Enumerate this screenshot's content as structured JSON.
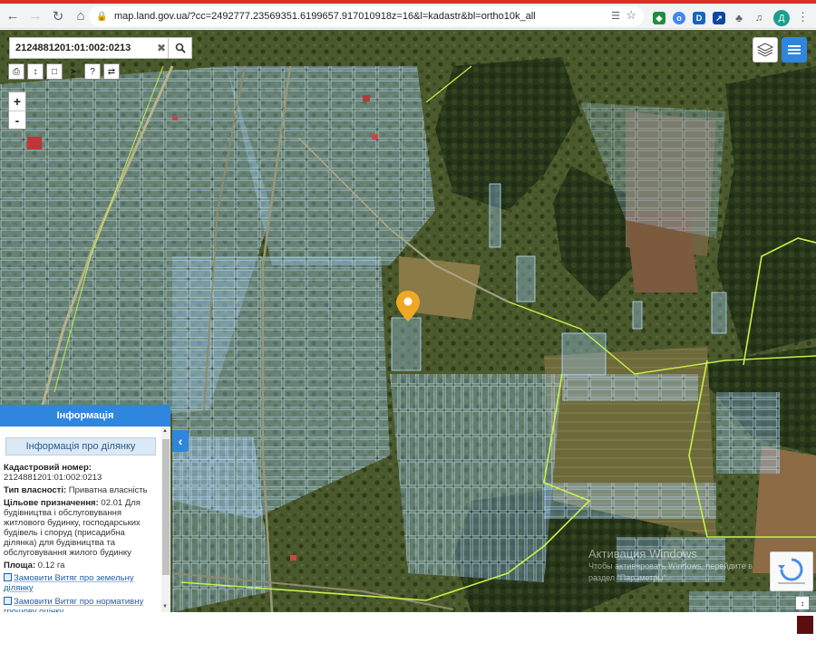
{
  "browser": {
    "url": "map.land.gov.ua/?cc=2492777.23569351.6199657.917010918z=16&l=kadastr&bl=ortho10k_all",
    "avatar_letter": "Д",
    "accent": "#d93025"
  },
  "search": {
    "value": "2124881201:01:002:0213"
  },
  "panel": {
    "header": "Інформація",
    "subheader": "Інформація про ділянку",
    "cadastral_label": "Кадастровий номер:",
    "cadastral_value": "2124881201:01:002:0213",
    "ownership_label": "Тип власності:",
    "ownership_value": "Приватна власність",
    "purpose_label": "Цільове призначення:",
    "purpose_value": "02.01 Для будівництва і обслуговування житлового будинку, господарських будівель і споруд (присадибна ділянка) для будівництва та обслуговування жилого будинку",
    "area_label": "Площа:",
    "area_value": "0.12 га",
    "link1": "Замовити Витяг про земельну ділянку",
    "link2": "Замовити Витяг про нормативну грошову оцінку"
  },
  "watermark": {
    "line1": "Активация Windows",
    "line2": "Чтобы активировать Windows, перейдите в",
    "line3": "раздел \"Параметры\"."
  },
  "zoom": {
    "plus": "+",
    "minus": "-"
  },
  "colors": {
    "brand": "#2e86de",
    "parcel": "#9fd3ff",
    "boundary": "#c6f24a",
    "marker": "#f0a824"
  }
}
